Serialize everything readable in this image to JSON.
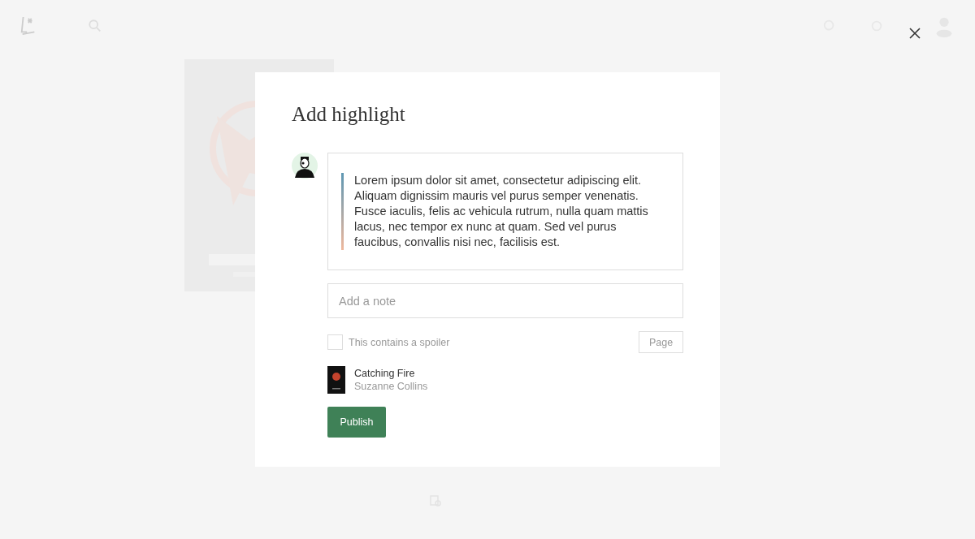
{
  "dialog": {
    "title": "Add highlight",
    "quote": "Lorem ipsum dolor sit amet, consectetur adipiscing elit. Aliquam dignissim mauris vel purus semper venenatis. Fusce iaculis, felis ac vehicula rutrum, nulla quam mattis lacus, nec tempor ex nunc at quam. Sed vel purus faucibus, convallis nisi nec, facilisis est.",
    "note": {
      "placeholder": "Add a note"
    },
    "spoiler": {
      "label": "This contains a spoiler",
      "checked": false
    },
    "page": {
      "placeholder": "Page"
    },
    "book": {
      "title": "Catching Fire",
      "author": "Suzanne Collins"
    },
    "publish_button": "Publish"
  }
}
